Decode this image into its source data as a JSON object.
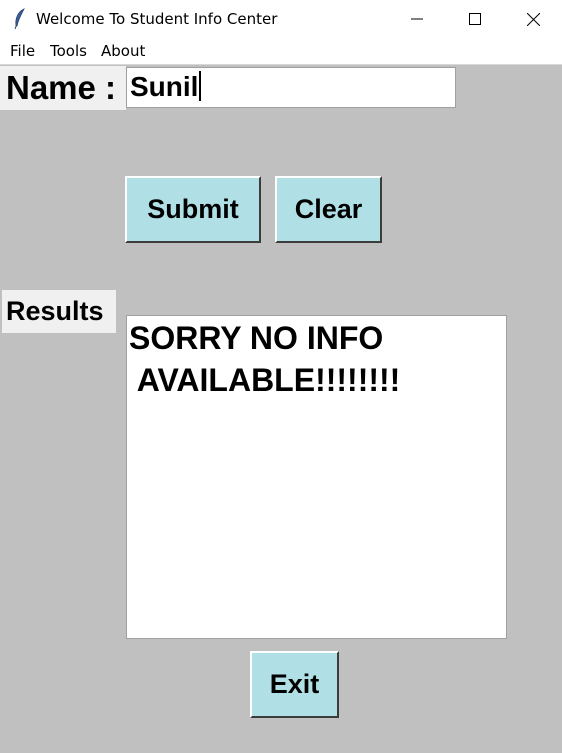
{
  "window": {
    "title": "Welcome To Student Info Center",
    "icon": "feather-icon",
    "controls": [
      "minimize-icon",
      "maximize-icon",
      "close-icon"
    ]
  },
  "menu": {
    "items": [
      {
        "label": "File"
      },
      {
        "label": "Tools"
      },
      {
        "label": "About"
      }
    ]
  },
  "form": {
    "name_label": "Name :",
    "name_value": "Sunil",
    "submit_label": "Submit",
    "clear_label": "Clear"
  },
  "results": {
    "label": "Results",
    "lines": [
      "SORRY NO INFO",
      " AVAILABLE!!!!!!!!"
    ]
  },
  "exit_label": "Exit",
  "colors": {
    "background": "#c0c0c0",
    "button": "#b0e0e6",
    "label_bg": "#f0f0f0"
  }
}
